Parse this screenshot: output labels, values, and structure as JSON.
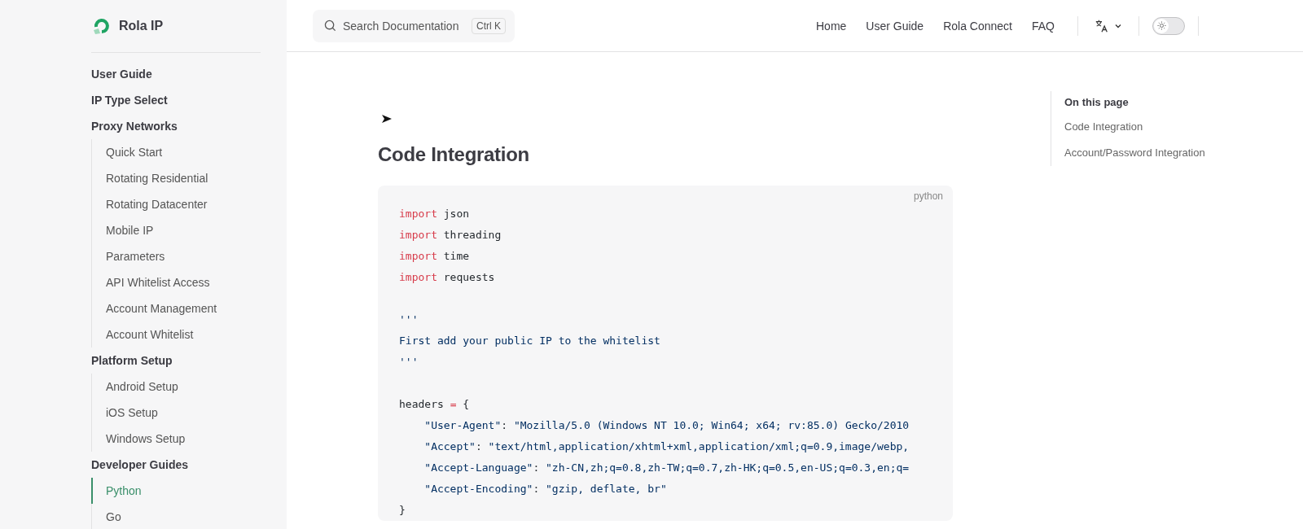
{
  "brand": {
    "name": "Rola IP"
  },
  "search": {
    "placeholder": "Search Documentation",
    "shortcut": "Ctrl K"
  },
  "nav": {
    "links": [
      {
        "label": "Home"
      },
      {
        "label": "User Guide"
      },
      {
        "label": "Rola Connect"
      },
      {
        "label": "FAQ"
      }
    ],
    "dark_mode": false
  },
  "sidebar": {
    "items": [
      {
        "label": "User Guide",
        "selected": false
      },
      {
        "label": "IP Type Select",
        "selected": false
      },
      {
        "label": "Proxy Networks",
        "selected": false,
        "children": [
          {
            "label": "Quick Start",
            "selected": false
          },
          {
            "label": "Rotating Residential",
            "selected": false
          },
          {
            "label": "Rotating Datacenter",
            "selected": false
          },
          {
            "label": "Mobile IP",
            "selected": false
          },
          {
            "label": "Parameters",
            "selected": false
          },
          {
            "label": "API Whitelist Access",
            "selected": false
          },
          {
            "label": "Account Management",
            "selected": false
          },
          {
            "label": "Account Whitelist",
            "selected": false
          }
        ]
      },
      {
        "label": "Platform Setup",
        "selected": false,
        "children": [
          {
            "label": "Android Setup",
            "selected": false
          },
          {
            "label": "iOS Setup",
            "selected": false
          },
          {
            "label": "Windows Setup",
            "selected": false
          }
        ]
      },
      {
        "label": "Developer Guides",
        "selected": false,
        "children": [
          {
            "label": "Python",
            "selected": true
          },
          {
            "label": "Go",
            "selected": false
          }
        ]
      }
    ]
  },
  "content": {
    "heading": "Code Integration",
    "code": {
      "language": "python",
      "lines": [
        {
          "kind": "code",
          "tokens": [
            {
              "kind": "keyword",
              "text": "import"
            },
            {
              "kind": "plain",
              "text": " json"
            }
          ]
        },
        {
          "kind": "code",
          "tokens": [
            {
              "kind": "keyword",
              "text": "import"
            },
            {
              "kind": "plain",
              "text": " threading"
            }
          ]
        },
        {
          "kind": "code",
          "tokens": [
            {
              "kind": "keyword",
              "text": "import"
            },
            {
              "kind": "plain",
              "text": " time"
            }
          ]
        },
        {
          "kind": "code",
          "tokens": [
            {
              "kind": "keyword",
              "text": "import"
            },
            {
              "kind": "plain",
              "text": " requests"
            }
          ]
        },
        {
          "kind": "blank"
        },
        {
          "kind": "code",
          "tokens": [
            {
              "kind": "string",
              "text": "'''"
            }
          ]
        },
        {
          "kind": "code",
          "tokens": [
            {
              "kind": "string",
              "text": "First add your public IP to the whitelist"
            }
          ]
        },
        {
          "kind": "code",
          "tokens": [
            {
              "kind": "string",
              "text": "'''"
            }
          ]
        },
        {
          "kind": "blank"
        },
        {
          "kind": "code",
          "tokens": [
            {
              "kind": "plain",
              "text": "headers "
            },
            {
              "kind": "operator",
              "text": "="
            },
            {
              "kind": "plain",
              "text": " {"
            }
          ]
        },
        {
          "kind": "code",
          "tokens": [
            {
              "kind": "string",
              "text": "    \"User-Agent\""
            },
            {
              "kind": "plain",
              "text": ": "
            },
            {
              "kind": "string",
              "text": "\"Mozilla/5.0 (Windows NT 10.0; Win64; x64; rv:85.0) Gecko/2010"
            }
          ]
        },
        {
          "kind": "code",
          "tokens": [
            {
              "kind": "string",
              "text": "    \"Accept\""
            },
            {
              "kind": "plain",
              "text": ": "
            },
            {
              "kind": "string",
              "text": "\"text/html,application/xhtml+xml,application/xml;q=0.9,image/webp,"
            }
          ]
        },
        {
          "kind": "code",
          "tokens": [
            {
              "kind": "string",
              "text": "    \"Accept-Language\""
            },
            {
              "kind": "plain",
              "text": ": "
            },
            {
              "kind": "string",
              "text": "\"zh-CN,zh;q=0.8,zh-TW;q=0.7,zh-HK;q=0.5,en-US;q=0.3,en;q="
            }
          ]
        },
        {
          "kind": "code",
          "tokens": [
            {
              "kind": "string",
              "text": "    \"Accept-Encoding\""
            },
            {
              "kind": "plain",
              "text": ": "
            },
            {
              "kind": "string",
              "text": "\"gzip, deflate, br\""
            }
          ]
        },
        {
          "kind": "code",
          "tokens": [
            {
              "kind": "plain",
              "text": "}"
            }
          ]
        }
      ]
    }
  },
  "toc": {
    "title": "On this page",
    "items": [
      {
        "label": "Code Integration",
        "selected": false
      },
      {
        "label": "Account/Password Integration",
        "selected": false
      }
    ]
  }
}
